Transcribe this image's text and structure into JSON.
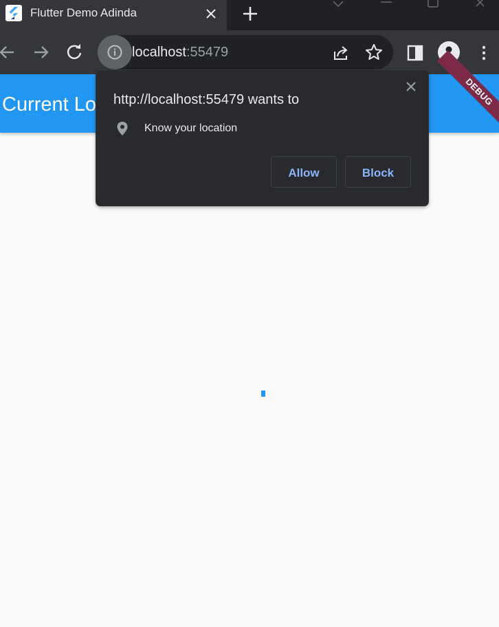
{
  "browser": {
    "tab": {
      "title": "Flutter Demo Adinda"
    },
    "address_bar": {
      "host": "localhost",
      "port": ":55479"
    }
  },
  "app": {
    "appbar_title": "Current Lo",
    "debug_banner": "DEBUG",
    "progress_indicator": {
      "color": "#2196f3"
    }
  },
  "permission_prompt": {
    "origin_text": "http://localhost:55479 wants to",
    "request_text": "Know your location",
    "allow_label": "Allow",
    "block_label": "Block"
  },
  "colors": {
    "app_bar": "#2196f3",
    "debug_ribbon": "#7d2a48",
    "prompt_button_text": "#8ab4f8",
    "browser_frame": "#35363a"
  },
  "icons": [
    "flutter-favicon-icon",
    "close-icon",
    "plus-icon",
    "back-arrow-icon",
    "forward-arrow-icon",
    "reload-icon",
    "info-icon",
    "share-icon",
    "star-icon",
    "side-panel-icon",
    "profile-icon",
    "kebab-menu-icon",
    "location-pin-icon"
  ]
}
